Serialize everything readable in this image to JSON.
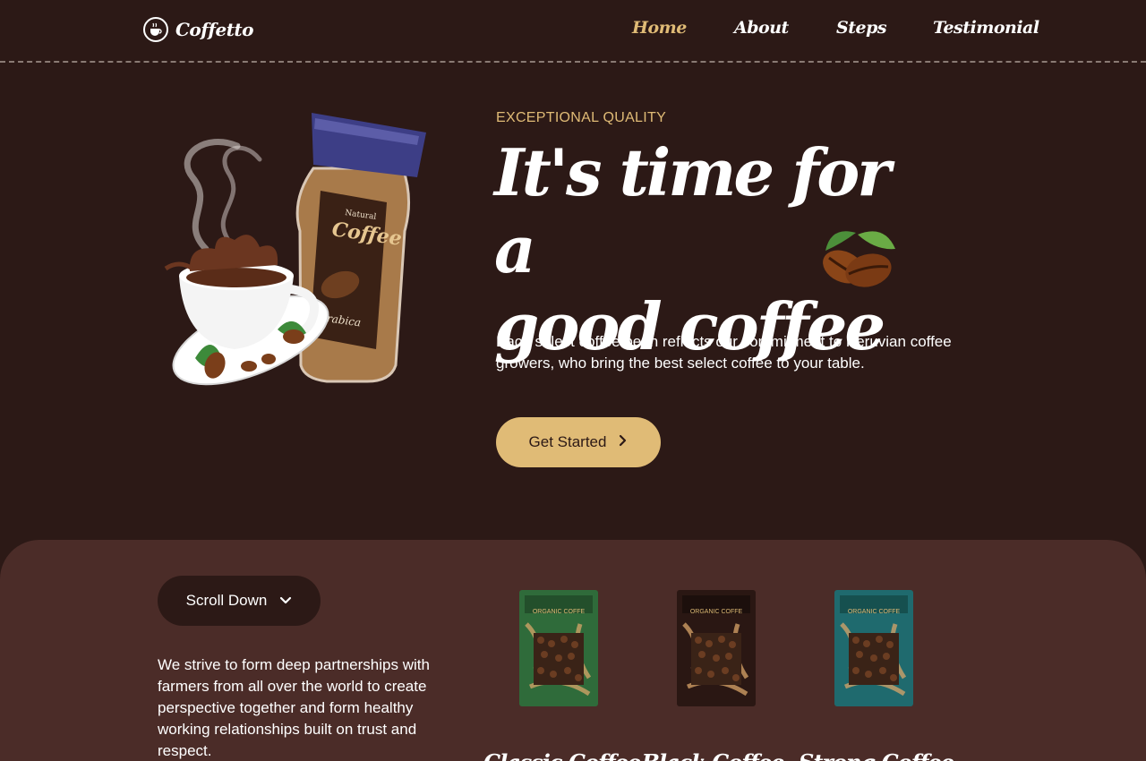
{
  "brand": {
    "name": "Coffetto"
  },
  "nav": {
    "items": [
      {
        "label": "Home",
        "active": true
      },
      {
        "label": "About",
        "active": false
      },
      {
        "label": "Steps",
        "active": false
      },
      {
        "label": "Testimonial",
        "active": false
      }
    ]
  },
  "hero": {
    "eyebrow": "EXCEPTIONAL QUALITY",
    "title_line1": "It's time for a",
    "title_line2": "good coffee",
    "description": "Each select coffee bean reflects our commitment to Peruvian coffee growers, who bring the best select coffee to your table.",
    "cta_label": "Get Started",
    "jar_label": "Coffee",
    "jar_top_label": "Natural",
    "jar_bottom_label": "Arabica"
  },
  "lower": {
    "scroll_label": "Scroll Down",
    "text": "We strive to form deep partnerships with farmers from all over the world to create perspective together and form healthy working relationships built on trust and respect.",
    "products": [
      {
        "name": "Classic Coffee",
        "pack_label": "ORGANIC COFFE",
        "color": "#2f6b3a"
      },
      {
        "name": "Black Coffee",
        "pack_label": "ORGANIC COFFE",
        "color": "#2a1713"
      },
      {
        "name": "Strong Coffee",
        "pack_label": "ORGANIC COFFE",
        "color": "#1f6a6e"
      }
    ]
  },
  "colors": {
    "background": "#2c1916",
    "panel": "#4b2c28",
    "accent": "#e0bb76"
  },
  "icons": {
    "logo": "coffee-cup-icon",
    "cta": "chevron-right-icon",
    "scroll": "chevron-down-icon",
    "hero_decoration": "coffee-beans-icon"
  }
}
